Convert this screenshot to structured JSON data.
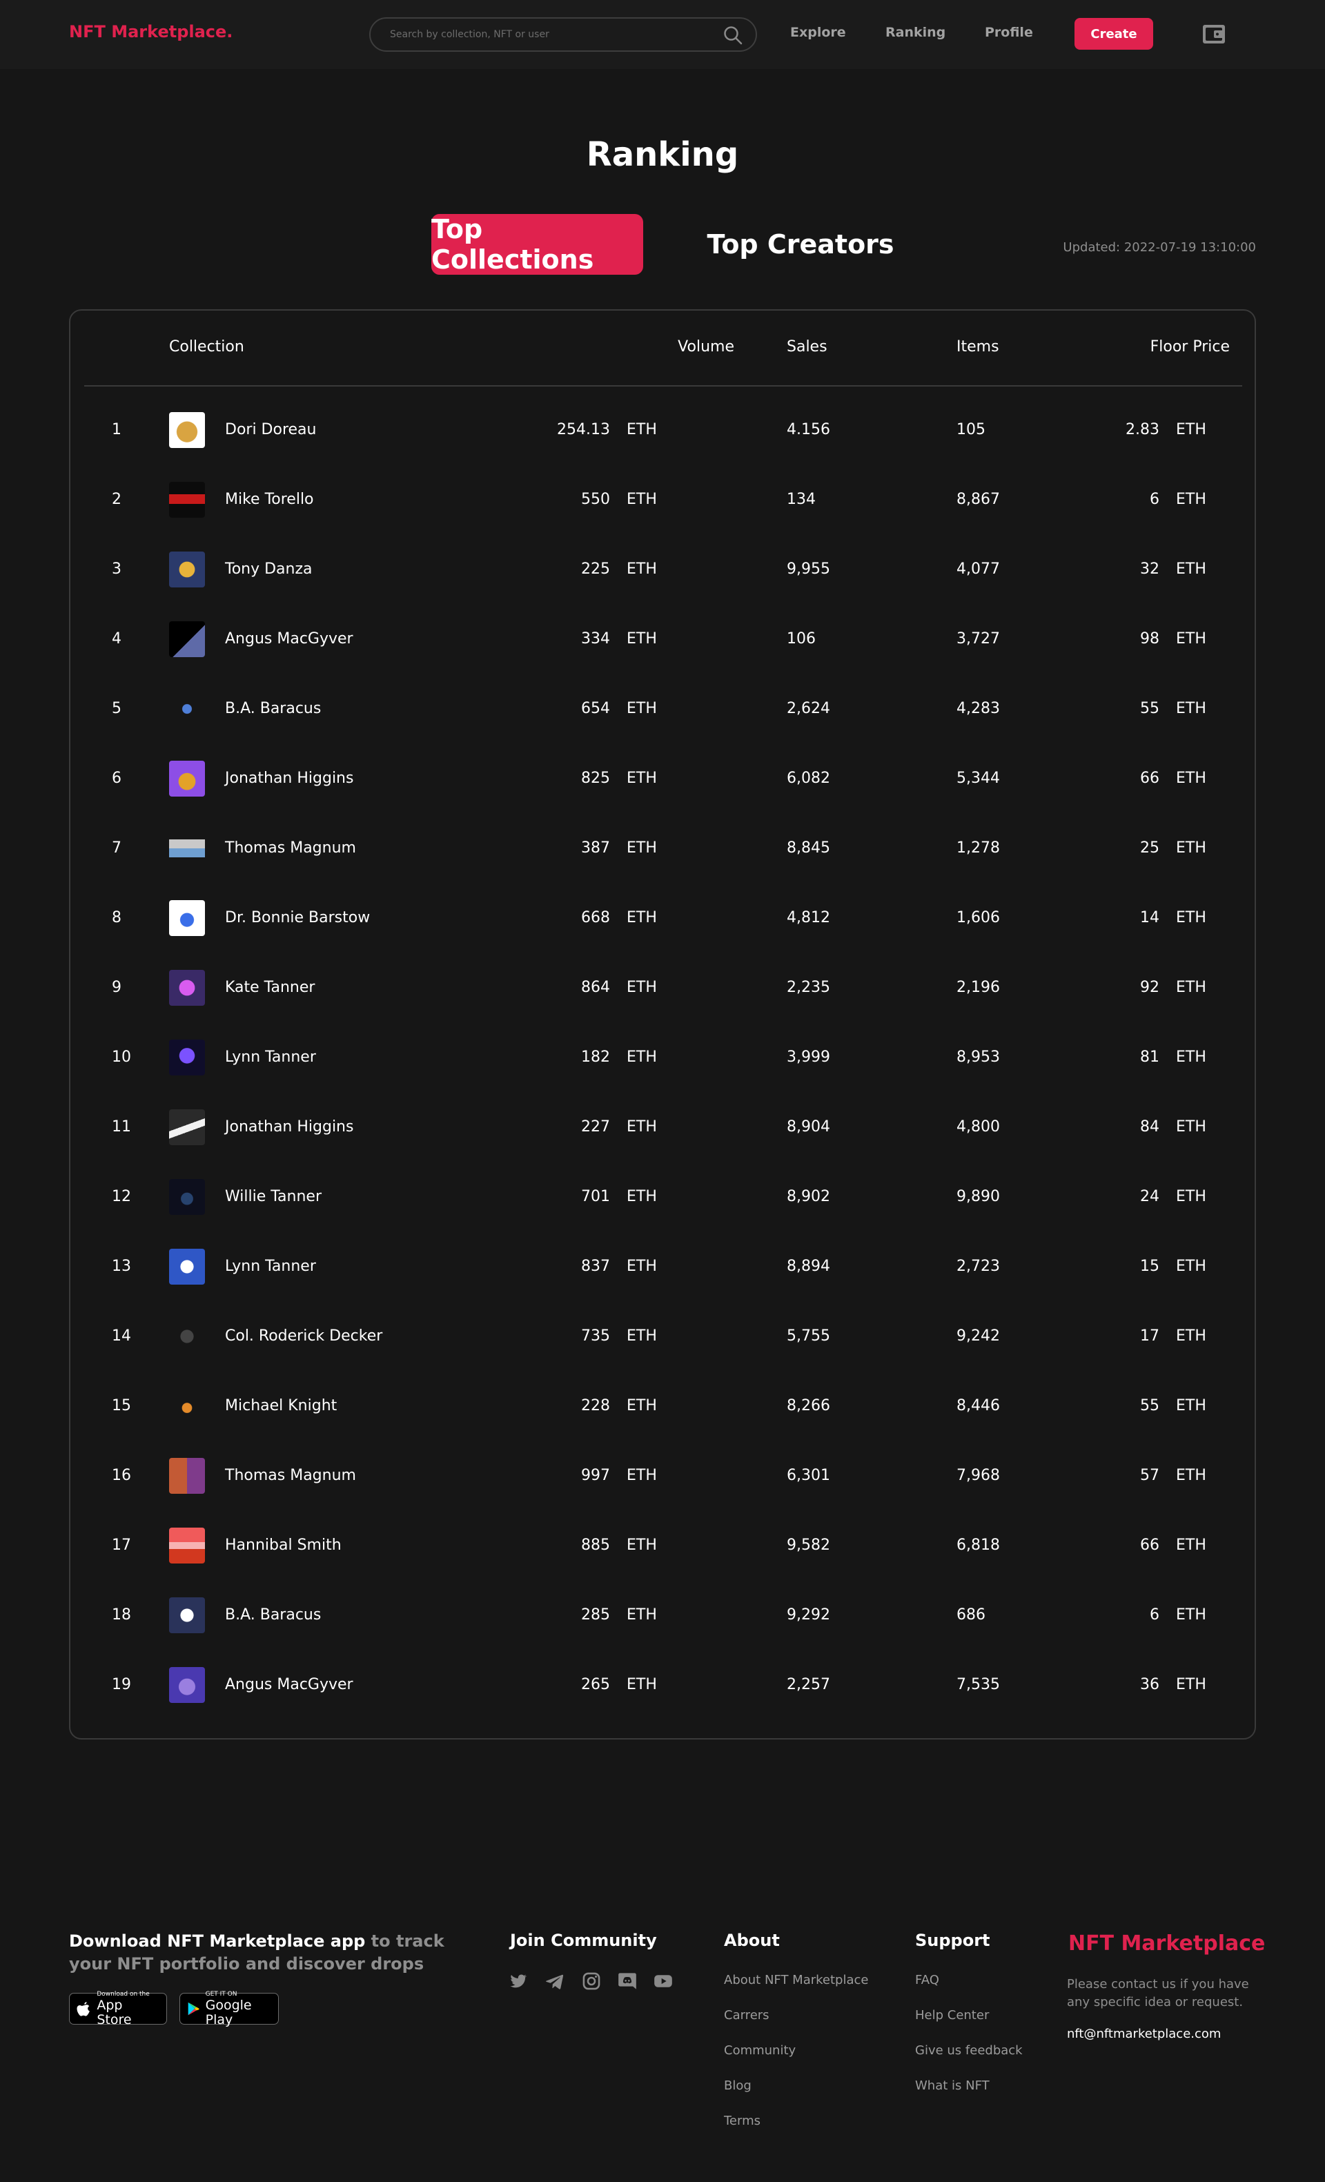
{
  "header": {
    "brand": "NFT Marketplace.",
    "search_placeholder": "Search by collection, NFT or user",
    "nav": {
      "explore": "Explore",
      "ranking": "Ranking",
      "profile": "Profile"
    },
    "create_label": "Create"
  },
  "page": {
    "title": "Ranking",
    "tabs": {
      "top_collections": "Top Collections",
      "top_creators": "Top Creators"
    },
    "updated": "Updated: 2022-07-19 13:10:00"
  },
  "table": {
    "columns": {
      "collection": "Collection",
      "volume": "Volume",
      "sales": "Sales",
      "items": "Items",
      "floor_price": "Floor Price"
    },
    "rows": [
      {
        "rank": "1",
        "name": "Dori Doreau",
        "volume": "254.13",
        "volume_unit": "ETH",
        "sales": "4.156",
        "items": "105",
        "floor": "2.83",
        "floor_unit": "ETH"
      },
      {
        "rank": "2",
        "name": "Mike Torello",
        "volume": "550",
        "volume_unit": "ETH",
        "sales": "134",
        "items": "8,867",
        "floor": "6",
        "floor_unit": "ETH"
      },
      {
        "rank": "3",
        "name": "Tony Danza",
        "volume": "225",
        "volume_unit": "ETH",
        "sales": "9,955",
        "items": "4,077",
        "floor": "32",
        "floor_unit": "ETH"
      },
      {
        "rank": "4",
        "name": "Angus MacGyver",
        "volume": "334",
        "volume_unit": "ETH",
        "sales": "106",
        "items": "3,727",
        "floor": "98",
        "floor_unit": "ETH"
      },
      {
        "rank": "5",
        "name": "B.A. Baracus",
        "volume": "654",
        "volume_unit": "ETH",
        "sales": "2,624",
        "items": "4,283",
        "floor": "55",
        "floor_unit": "ETH"
      },
      {
        "rank": "6",
        "name": "Jonathan Higgins",
        "volume": "825",
        "volume_unit": "ETH",
        "sales": "6,082",
        "items": "5,344",
        "floor": "66",
        "floor_unit": "ETH"
      },
      {
        "rank": "7",
        "name": "Thomas Magnum",
        "volume": "387",
        "volume_unit": "ETH",
        "sales": "8,845",
        "items": "1,278",
        "floor": "25",
        "floor_unit": "ETH"
      },
      {
        "rank": "8",
        "name": "Dr. Bonnie Barstow",
        "volume": "668",
        "volume_unit": "ETH",
        "sales": "4,812",
        "items": "1,606",
        "floor": "14",
        "floor_unit": "ETH"
      },
      {
        "rank": "9",
        "name": "Kate Tanner",
        "volume": "864",
        "volume_unit": "ETH",
        "sales": "2,235",
        "items": "2,196",
        "floor": "92",
        "floor_unit": "ETH"
      },
      {
        "rank": "10",
        "name": "Lynn Tanner",
        "volume": "182",
        "volume_unit": "ETH",
        "sales": "3,999",
        "items": "8,953",
        "floor": "81",
        "floor_unit": "ETH"
      },
      {
        "rank": "11",
        "name": "Jonathan Higgins",
        "volume": "227",
        "volume_unit": "ETH",
        "sales": "8,904",
        "items": "4,800",
        "floor": "84",
        "floor_unit": "ETH"
      },
      {
        "rank": "12",
        "name": "Willie Tanner",
        "volume": "701",
        "volume_unit": "ETH",
        "sales": "8,902",
        "items": "9,890",
        "floor": "24",
        "floor_unit": "ETH"
      },
      {
        "rank": "13",
        "name": "Lynn Tanner",
        "volume": "837",
        "volume_unit": "ETH",
        "sales": "8,894",
        "items": "2,723",
        "floor": "15",
        "floor_unit": "ETH"
      },
      {
        "rank": "14",
        "name": "Col. Roderick Decker",
        "volume": "735",
        "volume_unit": "ETH",
        "sales": "5,755",
        "items": "9,242",
        "floor": "17",
        "floor_unit": "ETH"
      },
      {
        "rank": "15",
        "name": "Michael Knight",
        "volume": "228",
        "volume_unit": "ETH",
        "sales": "8,266",
        "items": "8,446",
        "floor": "55",
        "floor_unit": "ETH"
      },
      {
        "rank": "16",
        "name": "Thomas Magnum",
        "volume": "997",
        "volume_unit": "ETH",
        "sales": "6,301",
        "items": "7,968",
        "floor": "57",
        "floor_unit": "ETH"
      },
      {
        "rank": "17",
        "name": "Hannibal Smith",
        "volume": "885",
        "volume_unit": "ETH",
        "sales": "9,582",
        "items": "6,818",
        "floor": "66",
        "floor_unit": "ETH"
      },
      {
        "rank": "18",
        "name": "B.A. Baracus",
        "volume": "285",
        "volume_unit": "ETH",
        "sales": "9,292",
        "items": "686",
        "floor": "6",
        "floor_unit": "ETH"
      },
      {
        "rank": "19",
        "name": "Angus MacGyver",
        "volume": "265",
        "volume_unit": "ETH",
        "sales": "2,257",
        "items": "7,535",
        "floor": "36",
        "floor_unit": "ETH"
      }
    ]
  },
  "footer": {
    "download_highlight": "Download NFT Marketplace app",
    "download_rest": " to track your NFT portfolio and discover drops",
    "app_store": {
      "small": "Download on the",
      "big": "App Store"
    },
    "google_play": {
      "small": "GET IT ON",
      "big": "Google Play"
    },
    "join_title": "Join Community",
    "about": {
      "title": "About",
      "links": [
        "About NFT Marketplace",
        "Carrers",
        "Community",
        "Blog",
        "Terms"
      ]
    },
    "support": {
      "title": "Support",
      "links": [
        "FAQ",
        "Help Center",
        "Give us feedback",
        "What is NFT"
      ]
    },
    "brand": "NFT Marketplace",
    "contact": "Please contact us if you have any specific idea or request.",
    "email": "nft@nftmarketplace.com"
  },
  "colors": {
    "accent": "#e0224e",
    "background": "#161616",
    "header_bg": "#1b1b1b",
    "muted_text": "#8e8e8e"
  },
  "icons": {
    "search": "search-icon",
    "wallet": "wallet-icon",
    "social": [
      "twitter-icon",
      "telegram-icon",
      "instagram-icon",
      "discord-icon",
      "youtube-icon"
    ],
    "store": [
      "apple-icon",
      "google-play-icon"
    ]
  }
}
